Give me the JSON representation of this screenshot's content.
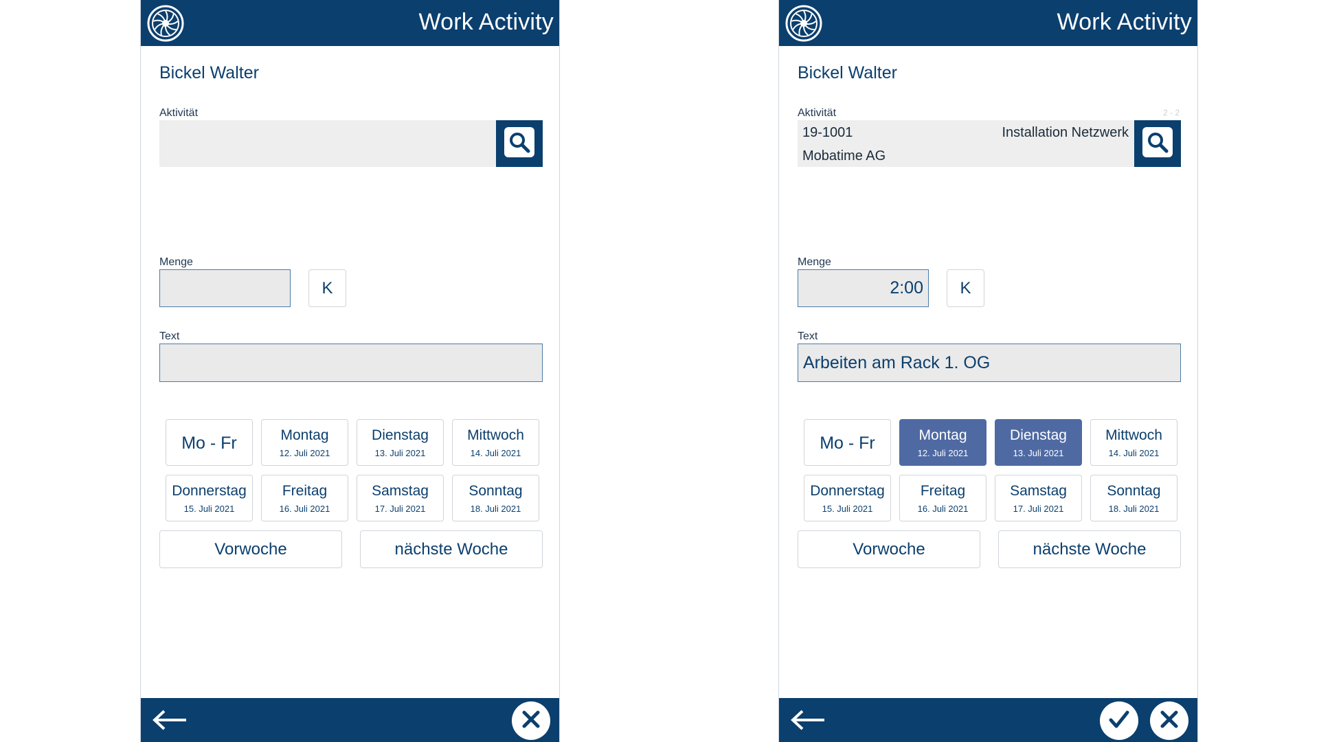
{
  "colors": {
    "brand": "#0b3f6e",
    "selected_day": "#4f6aa3",
    "field_bg": "#eaeaea"
  },
  "icons": {
    "logo": "turbine-logo-icon",
    "search": "search-icon",
    "back": "arrow-left-icon",
    "confirm": "check-icon",
    "cancel": "close-icon"
  },
  "screens": [
    {
      "header": {
        "title": "Work Activity"
      },
      "user": "Bickel Walter",
      "activity": {
        "label": "Aktivität",
        "counter": "",
        "code": "",
        "description": "",
        "company": ""
      },
      "quantity": {
        "label": "Menge",
        "value": "",
        "k_label": "K"
      },
      "text": {
        "label": "Text",
        "value": ""
      },
      "days": [
        {
          "name": "Mo - Fr",
          "date": "",
          "selected": false
        },
        {
          "name": "Montag",
          "date": "12. Juli 2021",
          "selected": false
        },
        {
          "name": "Dienstag",
          "date": "13. Juli 2021",
          "selected": false
        },
        {
          "name": "Mittwoch",
          "date": "14. Juli 2021",
          "selected": false
        },
        {
          "name": "Donnerstag",
          "date": "15. Juli 2021",
          "selected": false
        },
        {
          "name": "Freitag",
          "date": "16. Juli 2021",
          "selected": false
        },
        {
          "name": "Samstag",
          "date": "17. Juli 2021",
          "selected": false
        },
        {
          "name": "Sonntag",
          "date": "18. Juli 2021",
          "selected": false
        }
      ],
      "week_nav": {
        "prev": "Vorwoche",
        "next": "nächste Woche"
      },
      "bottom": {
        "show_confirm": false
      }
    },
    {
      "header": {
        "title": "Work Activity"
      },
      "user": "Bickel Walter",
      "activity": {
        "label": "Aktivität",
        "counter": "2 - 2",
        "code": "19-1001",
        "description": "Installation Netzwerk",
        "company": "Mobatime AG"
      },
      "quantity": {
        "label": "Menge",
        "value": "2:00",
        "k_label": "K"
      },
      "text": {
        "label": "Text",
        "value": "Arbeiten am Rack 1. OG"
      },
      "days": [
        {
          "name": "Mo - Fr",
          "date": "",
          "selected": false
        },
        {
          "name": "Montag",
          "date": "12. Juli 2021",
          "selected": true
        },
        {
          "name": "Dienstag",
          "date": "13. Juli 2021",
          "selected": true
        },
        {
          "name": "Mittwoch",
          "date": "14. Juli 2021",
          "selected": false
        },
        {
          "name": "Donnerstag",
          "date": "15. Juli 2021",
          "selected": false
        },
        {
          "name": "Freitag",
          "date": "16. Juli 2021",
          "selected": false
        },
        {
          "name": "Samstag",
          "date": "17. Juli 2021",
          "selected": false
        },
        {
          "name": "Sonntag",
          "date": "18. Juli 2021",
          "selected": false
        }
      ],
      "week_nav": {
        "prev": "Vorwoche",
        "next": "nächste Woche"
      },
      "bottom": {
        "show_confirm": true
      }
    }
  ]
}
